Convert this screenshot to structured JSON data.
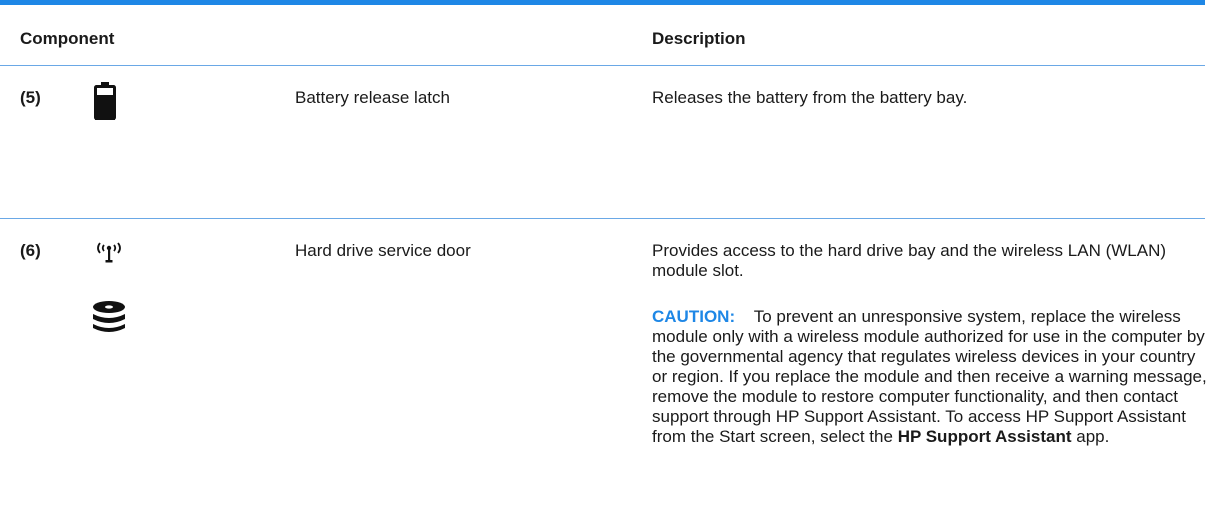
{
  "table": {
    "headers": {
      "component": "Component",
      "description": "Description"
    },
    "rows": [
      {
        "number": "(5)",
        "icons": [
          "battery-icon"
        ],
        "name": "Battery release latch",
        "description": "Releases the battery from the battery bay."
      },
      {
        "number": "(6)",
        "icons": [
          "wireless-icon",
          "hard-drive-icon"
        ],
        "name": "Hard drive service door",
        "description": "Provides access to the hard drive bay and the wireless LAN (WLAN) module slot.",
        "caution": {
          "label": "CAUTION:",
          "text": "To prevent an unresponsive system, replace the wireless module only with a wireless module authorized for use in the computer by the governmental agency that regulates wireless devices in your country or region. If you replace the module and then receive a warning message, remove the module to restore computer functionality, and then contact support through HP Support Assistant. To access HP Support Assistant from the Start screen, select the",
          "bold": "HP Support Assistant",
          "suffix": "app."
        }
      }
    ]
  },
  "colors": {
    "accent": "#1e87e6",
    "rule": "#6aa8e6",
    "text": "#1a1a1a"
  }
}
